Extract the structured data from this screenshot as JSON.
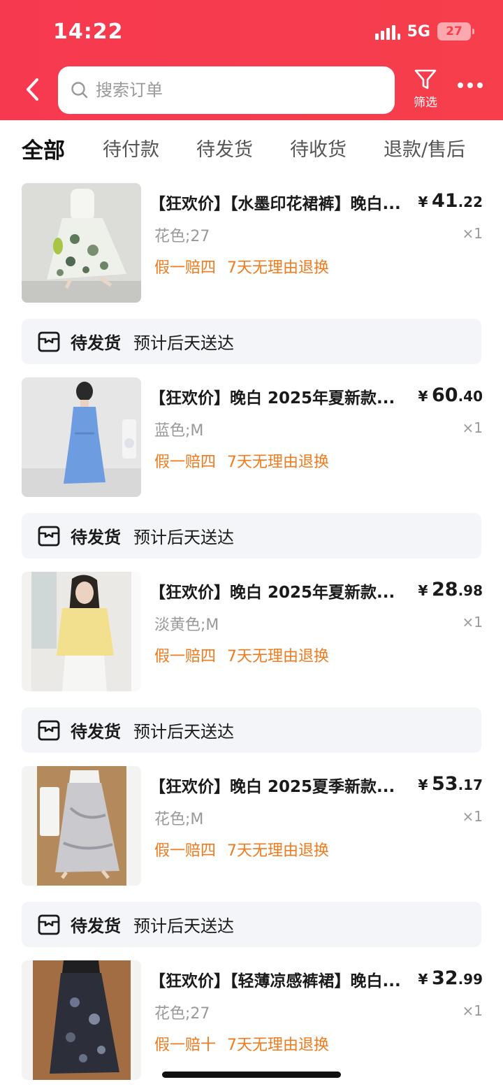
{
  "status_bar": {
    "time": "14:22",
    "network": "5G",
    "battery": "27"
  },
  "header": {
    "search_placeholder": "搜索订单",
    "filter_label": "筛选"
  },
  "tabs": [
    {
      "label": "全部",
      "active": true
    },
    {
      "label": "待付款",
      "active": false
    },
    {
      "label": "待发货",
      "active": false
    },
    {
      "label": "待收货",
      "active": false
    },
    {
      "label": "退款/售后",
      "active": false
    }
  ],
  "orders": [
    {
      "title": "【狂欢价】【水墨印花裙裤】晚白...",
      "price_currency": "¥",
      "price_int": "41",
      "price_dec": ".22",
      "spec": "花色;27",
      "qty": "×1",
      "tags": [
        "假一赔四",
        "7天无理由退换"
      ],
      "thumb_colors": [
        "#c9c9c6",
        "#dedede",
        "#f7f7f4"
      ]
    },
    {
      "title": "【狂欢价】晚白 2025年夏新款...",
      "price_currency": "¥",
      "price_int": "60",
      "price_dec": ".40",
      "spec": "蓝色;M",
      "qty": "×1",
      "tags": [
        "假一赔四",
        "7天无理由退换"
      ],
      "thumb_colors": [
        "#e4e4e4",
        "#6b9be0",
        "#eeeeee"
      ]
    },
    {
      "title": "【狂欢价】晚白 2025年夏新款...",
      "price_currency": "¥",
      "price_int": "28",
      "price_dec": ".98",
      "spec": "淡黄色;M",
      "qty": "×1",
      "tags": [
        "假一赔四",
        "7天无理由退换"
      ],
      "thumb_colors": [
        "#e8e6e2",
        "#f2e08f",
        "#f4f4f1"
      ]
    },
    {
      "title": "【狂欢价】晚白 2025夏季新款...",
      "price_currency": "¥",
      "price_int": "53",
      "price_dec": ".17",
      "spec": "花色;M",
      "qty": "×1",
      "tags": [
        "假一赔四",
        "7天无理由退换"
      ],
      "thumb_colors": [
        "#b48a5c",
        "#c9c9cc",
        "#d9d6d2"
      ]
    },
    {
      "title": "【狂欢价】【轻薄凉感裤裙】晚白...",
      "price_currency": "¥",
      "price_int": "32",
      "price_dec": ".99",
      "spec": "花色;27",
      "qty": "×1",
      "tags": [
        "假一赔十",
        "7天无理由退换"
      ],
      "thumb_colors": [
        "#a36d44",
        "#2c2f3a",
        "#c6a88a"
      ]
    }
  ],
  "shipping": [
    {
      "status": "待发货",
      "eta": "预计后天送达"
    },
    {
      "status": "待发货",
      "eta": "预计后天送达"
    },
    {
      "status": "待发货",
      "eta": "预计后天送达"
    },
    {
      "status": "待发货",
      "eta": "预计后天送达"
    }
  ],
  "colors": {
    "header_red": "#f63e4c",
    "tag_orange": "#f07a1c",
    "ship_bg": "#f3f5f9"
  }
}
